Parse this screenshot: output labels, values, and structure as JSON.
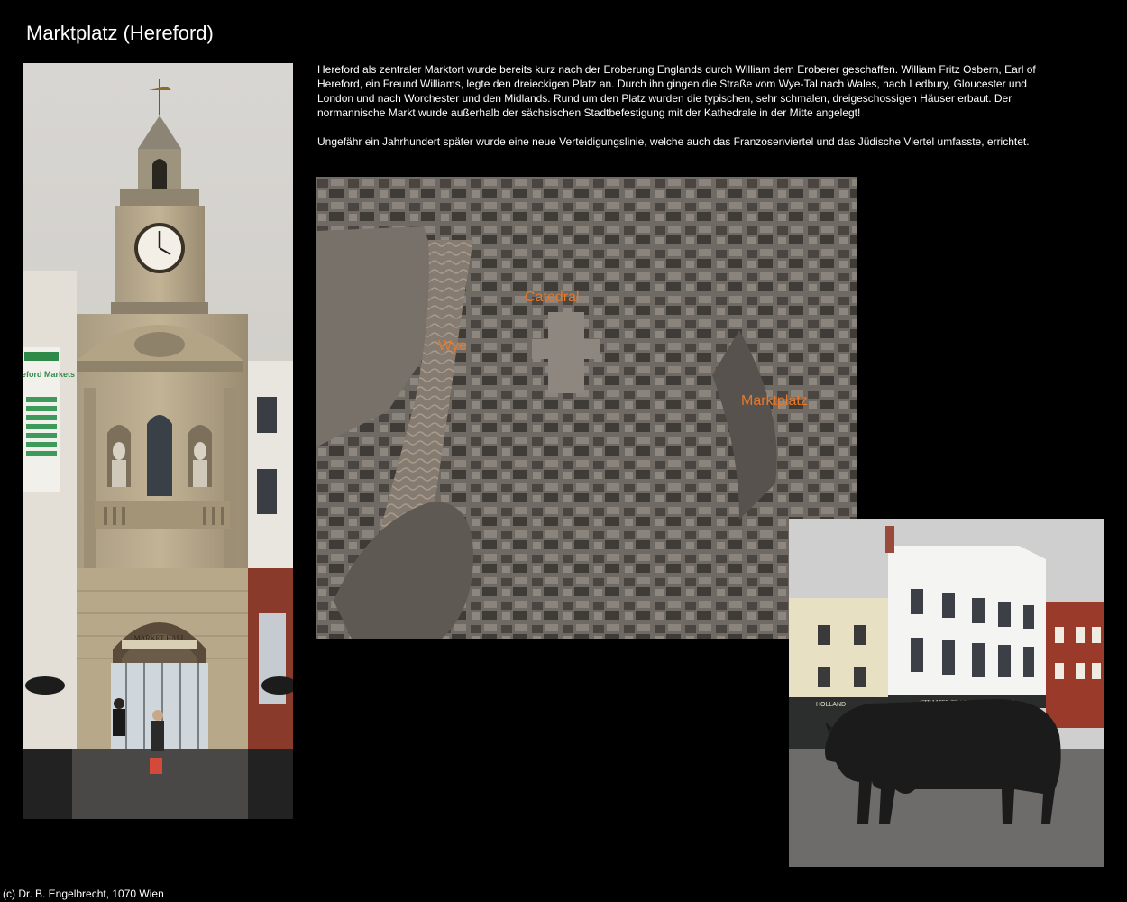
{
  "page": {
    "title": "Marktplatz (Hereford)",
    "copyright": "(c) Dr. B. Engelbrecht, 1070 Wien"
  },
  "text": {
    "paragraph1": "Hereford als zentraler Marktort wurde bereits kurz nach der Eroberung Englands durch William dem Eroberer geschaffen. William Fritz Osbern, Earl of Hereford, ein Freund Williams, legte den dreieckigen Platz an. Durch ihn gingen die Straße vom Wye-Tal nach Wales, nach Ledbury, Gloucester und London und nach Worchester und den Midlands. Rund um den Platz wurden die typischen, sehr schmalen, dreigeschossigen Häuser erbaut. Der normannische Markt wurde außerhalb der sächsischen Stadtbefestigung mit der Kathedrale in der Mitte angelegt!",
    "paragraph2": "Ungefähr ein Jahrhundert später wurde eine neue Verteidigungslinie, welche auch das Franzosenviertel und das Jüdische Viertel umfasste, errichtet."
  },
  "photos": {
    "clock_tower": {
      "banner_title": "Hereford Markets",
      "hall_sign": "MARKET HALL"
    },
    "map": {
      "label_river": "Wye",
      "label_cathedral": "Catedral",
      "label_market": "Marktplatz"
    },
    "bull": {
      "shop_left": "HOLLAND",
      "shop_main": "STEAMER TRADING COOKSHOP"
    }
  },
  "colors": {
    "background": "#000000",
    "map_label": "#e8782a"
  }
}
